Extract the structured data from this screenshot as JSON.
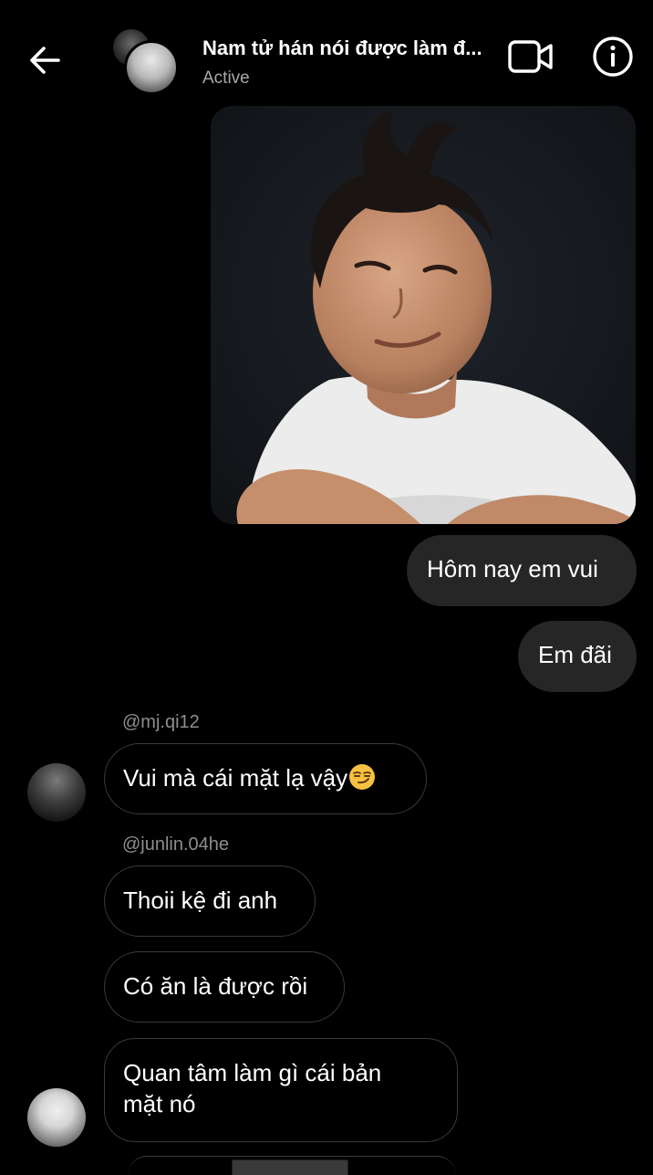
{
  "header": {
    "title": "Nam tử hán nói được làm đ...",
    "status": "Active",
    "icons": [
      "back-arrow-icon",
      "video-call-icon",
      "info-icon"
    ]
  },
  "messages": {
    "outgoing_1": "Hôm nay em vui",
    "outgoing_2": "Em đãi",
    "sender_1": "@mj.qi12",
    "incoming_1": "Vui mà cái mặt lạ vậy",
    "incoming_1_emoji": "smirk-emoji",
    "sender_2": "@junlin.04he",
    "incoming_2": "Thoii kệ đi anh",
    "incoming_3": "Có ăn là được rồi",
    "incoming_4_line1": "Quan tâm làm gì cái bản",
    "incoming_4_line2": "mặt nó"
  },
  "colors": {
    "background": "#000000",
    "outgoing_bubble": "#262626",
    "incoming_border": "#3a3a3a",
    "secondary_text": "#8e8e8e"
  }
}
